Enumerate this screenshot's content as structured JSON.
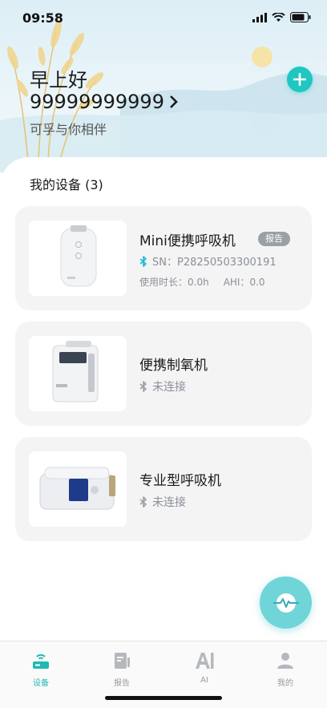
{
  "status_bar": {
    "time": "09:58"
  },
  "header": {
    "greeting": "早上好",
    "account": "99999999999",
    "tagline": "可孚与你相伴"
  },
  "devices_section": {
    "title": "我的设备 (3)"
  },
  "devices": [
    {
      "name": "Mini便携呼吸机",
      "report_label": "报告",
      "serial": "SN：P28250503300191",
      "usage": "使用时长：0.0h",
      "ahi": "AHI：0.0",
      "bluetooth": "connected"
    },
    {
      "name": "便携制氧机",
      "status": "未连接",
      "bluetooth": "disconnected"
    },
    {
      "name": "专业型呼吸机",
      "status": "未连接",
      "bluetooth": "disconnected"
    }
  ],
  "tabs": [
    {
      "label": "设备",
      "icon": "router-icon",
      "active": true
    },
    {
      "label": "报告",
      "icon": "document-icon",
      "active": false
    },
    {
      "label": "AI",
      "icon": "ai-icon",
      "active": false
    },
    {
      "label": "我的",
      "icon": "person-icon",
      "active": false
    }
  ],
  "colors": {
    "accent": "#1fc6c2",
    "tab_active": "#1fb8b4",
    "badge": "#9aa0a6",
    "card": "#f4f4f4"
  }
}
